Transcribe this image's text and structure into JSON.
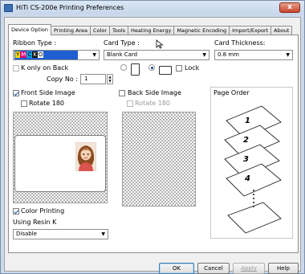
{
  "window": {
    "title": "HiTi CS-200e Printing Preferences",
    "close_glyph": "x"
  },
  "tabs": [
    {
      "label": "Device Option",
      "active": true
    },
    {
      "label": "Printing Area"
    },
    {
      "label": "Color"
    },
    {
      "label": "Tools"
    },
    {
      "label": "Heating Energy"
    },
    {
      "label": "Magnetic Encoding"
    },
    {
      "label": "Import/Export"
    },
    {
      "label": "About"
    }
  ],
  "ribbon": {
    "label": "Ribbon Type :",
    "value_y": "Y",
    "value_m": "M",
    "value_c": "C",
    "value_k": "K",
    "value_o": "O",
    "swatch_colors": [
      "#f2e200",
      "#e0007a",
      "#00a3e0",
      "#111111",
      "#ffffff",
      "#1f5fd1"
    ]
  },
  "card_type": {
    "label": "Card Type :",
    "value": "Blank Card"
  },
  "card_thickness": {
    "label": "Card Thickness:",
    "value": "0.8 mm"
  },
  "k_only": {
    "label": "K only on Back"
  },
  "copy_no": {
    "label": "Copy No :",
    "value": "1"
  },
  "lock": {
    "label": "Lock"
  },
  "front": {
    "label": "Front Side Image",
    "rotate": "Rotate 180",
    "color_printing": "Color Printing",
    "using_resin": "Using Resin K",
    "resin_value": "Disable"
  },
  "back": {
    "label": "Back Side Image",
    "rotate": "Rotate 180"
  },
  "page_order": {
    "label": "Page Order",
    "numbers": [
      "1",
      "2",
      "3",
      "4"
    ],
    "dots": "⋮"
  },
  "buttons": {
    "ok": "OK",
    "cancel": "Cancel",
    "apply": "Apply",
    "help": "Help"
  },
  "dropdown_arrow": "▼",
  "spin_up": "▲",
  "spin_down": "▼"
}
